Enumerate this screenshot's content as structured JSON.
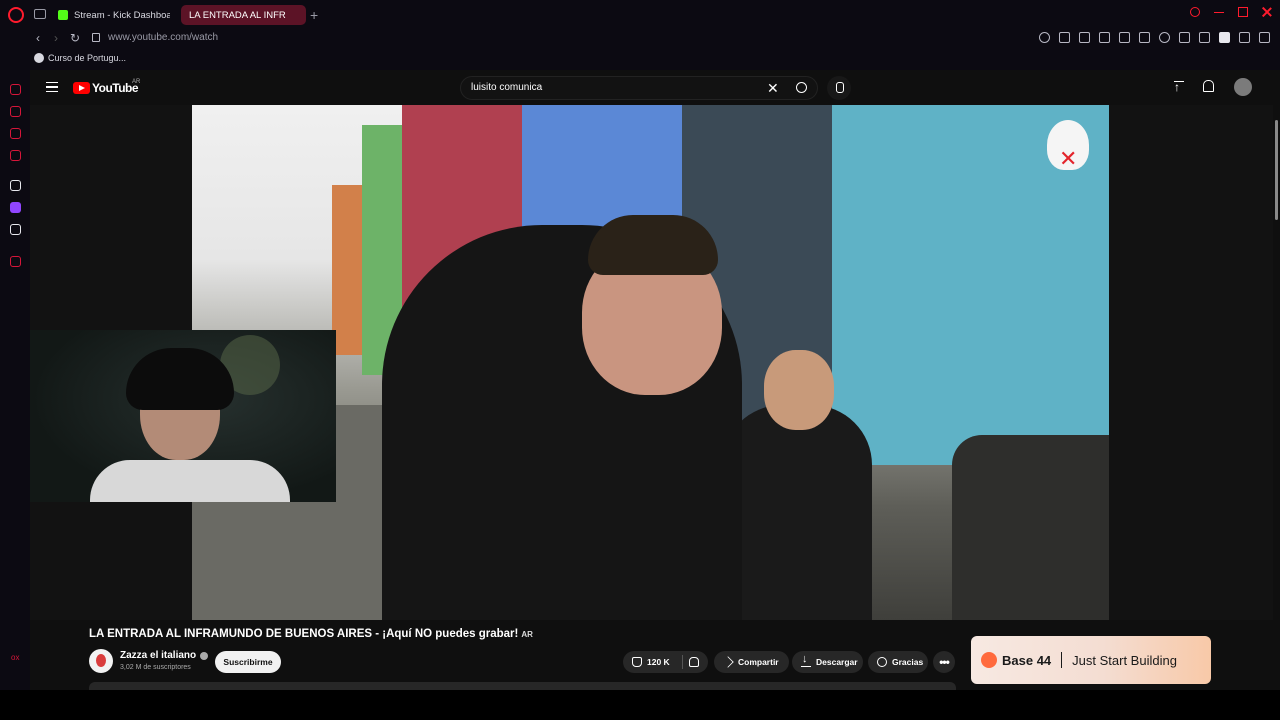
{
  "browser": {
    "tabs": [
      {
        "title": "Stream - Kick Dashboard",
        "favicon": "kick-icon"
      },
      {
        "title": "LA ENTRADA AL INFR",
        "favicon": "youtube-icon"
      }
    ],
    "new_tab": "+",
    "url": "www.youtube.com/watch",
    "bookmarks": [
      {
        "label": "Curso de Portugu..."
      }
    ],
    "sidebar_text": "ox",
    "accent_color": "#ff1b2d"
  },
  "youtube": {
    "logo": "YouTube",
    "country": "AR",
    "search": {
      "value": "luisito comunica",
      "clear": "✕"
    },
    "video": {
      "title": "LA ENTRADA AL INFRAMUNDO DE BUENOS AIRES - ¡Aquí NO puedes grabar!",
      "title_badge": "AR"
    },
    "channel": {
      "name": "Zazza el italiano",
      "subscribers": "3,02 M de suscriptores",
      "subscribe_label": "Suscribirme"
    },
    "actions": {
      "likes": "120 K",
      "share": "Compartir",
      "download": "Descargar",
      "thanks": "Gracias",
      "more": "•••"
    },
    "ad": {
      "brand": "Base 44",
      "tagline": "Just Start Building"
    }
  }
}
